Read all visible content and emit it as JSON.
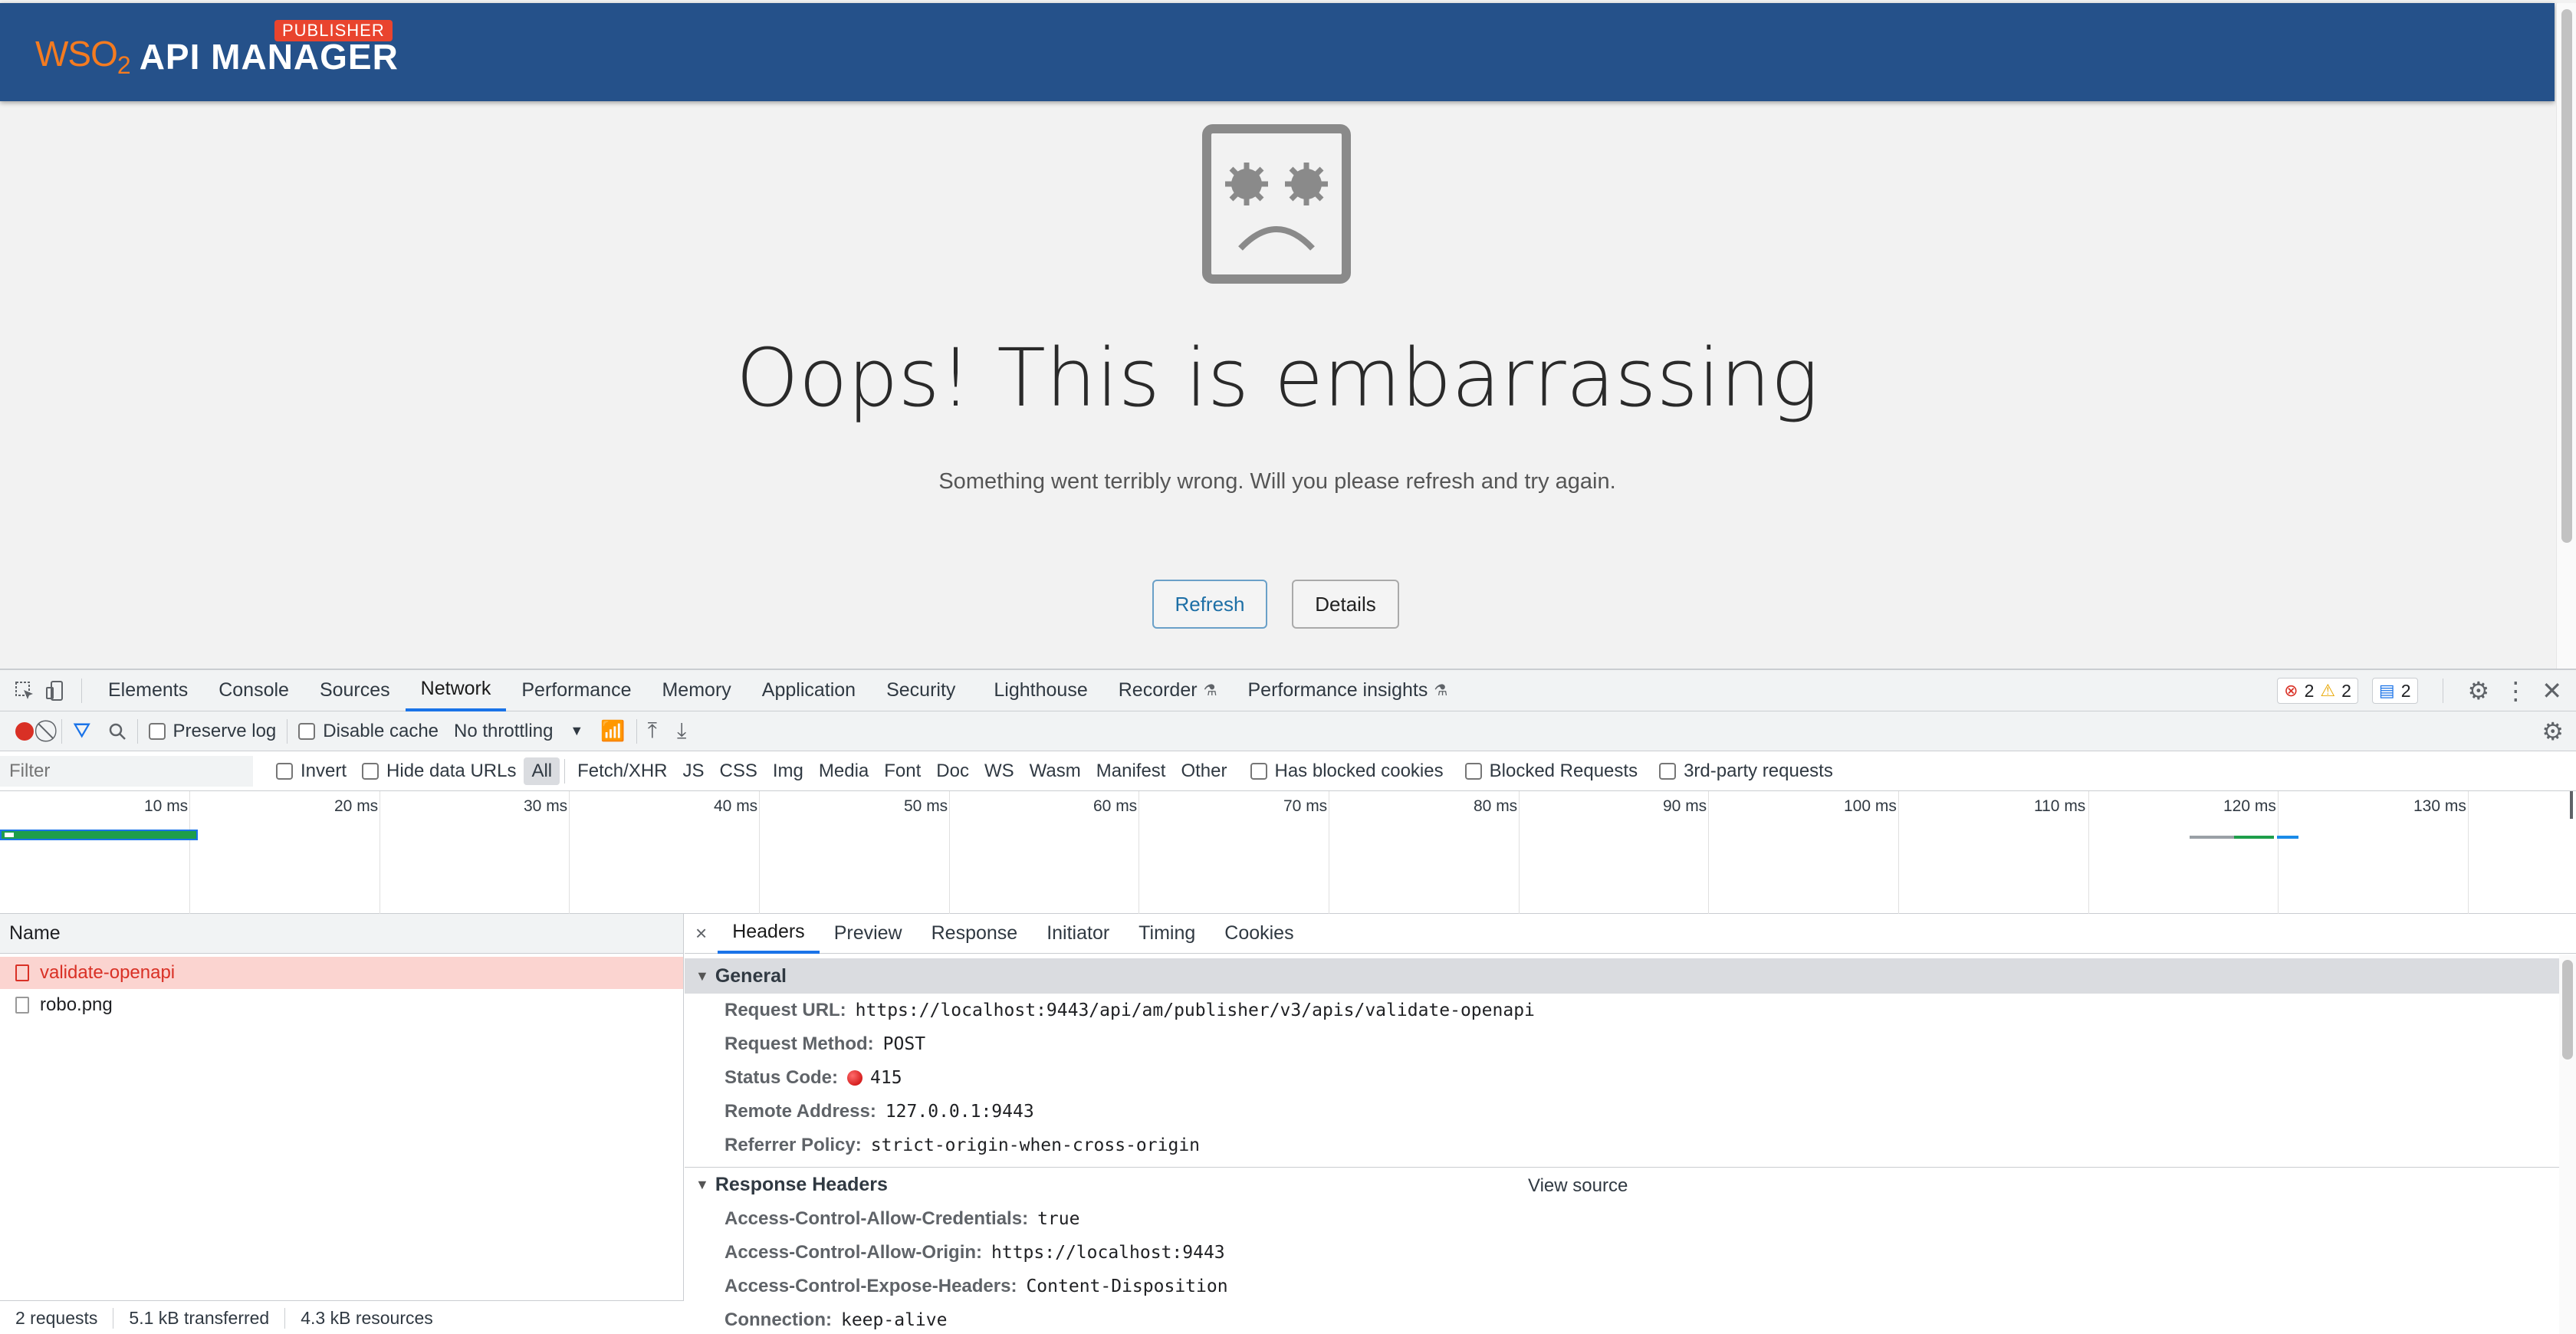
{
  "page": {
    "logo_text": "WSO",
    "logo_sub": "2",
    "app_title": "API MANAGER",
    "badge": "PUBLISHER",
    "error_title": "Oops! This is embarrassing",
    "error_message": "Something went terribly wrong. Will you please refresh and try again.",
    "refresh_label": "Refresh",
    "details_label": "Details"
  },
  "devtools": {
    "tabs": [
      "Elements",
      "Console",
      "Sources",
      "Network",
      "Performance",
      "Memory",
      "Application",
      "Security",
      "Lighthouse",
      "Recorder",
      "Performance insights"
    ],
    "active_tab": "Network",
    "counts": {
      "errors": "2",
      "warnings": "2",
      "messages": "2"
    },
    "toolbar": {
      "preserve_log": "Preserve log",
      "disable_cache": "Disable cache",
      "throttling": "No throttling"
    },
    "filter": {
      "placeholder": "Filter",
      "invert": "Invert",
      "hide_data_urls": "Hide data URLs",
      "types": [
        "All",
        "Fetch/XHR",
        "JS",
        "CSS",
        "Img",
        "Media",
        "Font",
        "Doc",
        "WS",
        "Wasm",
        "Manifest",
        "Other"
      ],
      "has_blocked_cookies": "Has blocked cookies",
      "blocked_requests": "Blocked Requests",
      "third_party": "3rd-party requests"
    },
    "timeline_ticks": [
      "10 ms",
      "20 ms",
      "30 ms",
      "40 ms",
      "50 ms",
      "60 ms",
      "70 ms",
      "80 ms",
      "90 ms",
      "100 ms",
      "110 ms",
      "120 ms",
      "130 ms"
    ],
    "requests": {
      "header": "Name",
      "rows": [
        {
          "name": "validate-openapi",
          "error": true
        },
        {
          "name": "robo.png",
          "error": false
        }
      ]
    },
    "status": {
      "requests": "2 requests",
      "transferred": "5.1 kB transferred",
      "resources": "4.3 kB resources"
    },
    "detail_tabs": [
      "Headers",
      "Preview",
      "Response",
      "Initiator",
      "Timing",
      "Cookies"
    ],
    "general": {
      "title": "General",
      "rows": [
        {
          "k": "Request URL:",
          "v": "https://localhost:9443/api/am/publisher/v3/apis/validate-openapi"
        },
        {
          "k": "Request Method:",
          "v": "POST"
        },
        {
          "k": "Status Code:",
          "v": "415"
        },
        {
          "k": "Remote Address:",
          "v": "127.0.0.1:9443"
        },
        {
          "k": "Referrer Policy:",
          "v": "strict-origin-when-cross-origin"
        }
      ]
    },
    "response_headers": {
      "title": "Response Headers",
      "view_source": "View source",
      "rows": [
        {
          "k": "Access-Control-Allow-Credentials:",
          "v": "true"
        },
        {
          "k": "Access-Control-Allow-Origin:",
          "v": "https://localhost:9443"
        },
        {
          "k": "Access-Control-Expose-Headers:",
          "v": "Content-Disposition"
        },
        {
          "k": "Connection:",
          "v": "keep-alive"
        }
      ]
    }
  }
}
